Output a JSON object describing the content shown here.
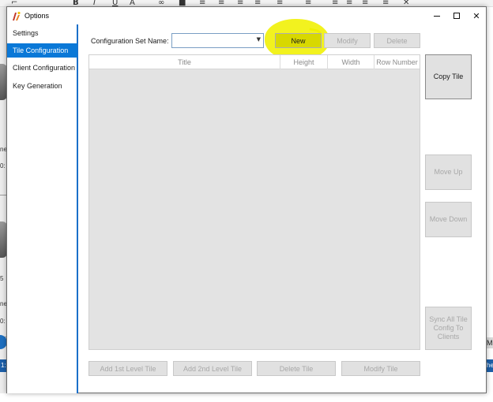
{
  "window": {
    "title": "Options",
    "controls": {
      "minimize": "minimize",
      "maximize": "maximize",
      "close": "✕"
    }
  },
  "sidebar": {
    "items": [
      {
        "label": "Settings",
        "active": false
      },
      {
        "label": "Tile Configuration",
        "active": true
      },
      {
        "label": "Client Configuration",
        "active": false
      },
      {
        "label": "Key Generation",
        "active": false
      }
    ]
  },
  "config": {
    "label": "Configuration Set Name:",
    "select_value": "",
    "arrow": "▼"
  },
  "buttons": {
    "new": "New",
    "modify": "Modify",
    "delete": "Delete",
    "copy_tile": "Copy Tile",
    "move_up": "Move Up",
    "move_down": "Move Down",
    "sync": "Sync All Tile Config To Clients",
    "add_1st": "Add 1st Level Tile",
    "add_2nd": "Add 2nd Level Tile",
    "delete_tile": "Delete Tile",
    "modify_tile": "Modify Tile"
  },
  "grid": {
    "columns": [
      "Title",
      "Height",
      "Width",
      "Row Number"
    ],
    "rows": []
  },
  "background": {
    "frags": [
      "ne",
      "0:",
      "5",
      "ne",
      "0:"
    ],
    "blue_left": "1:",
    "right_m": "M",
    "right_blue": "he"
  },
  "colors": {
    "accent": "#0a78d7",
    "highlight": "#f0f000",
    "button_bg": "#e1e1e1",
    "grid_bg": "#e3e3e3"
  }
}
